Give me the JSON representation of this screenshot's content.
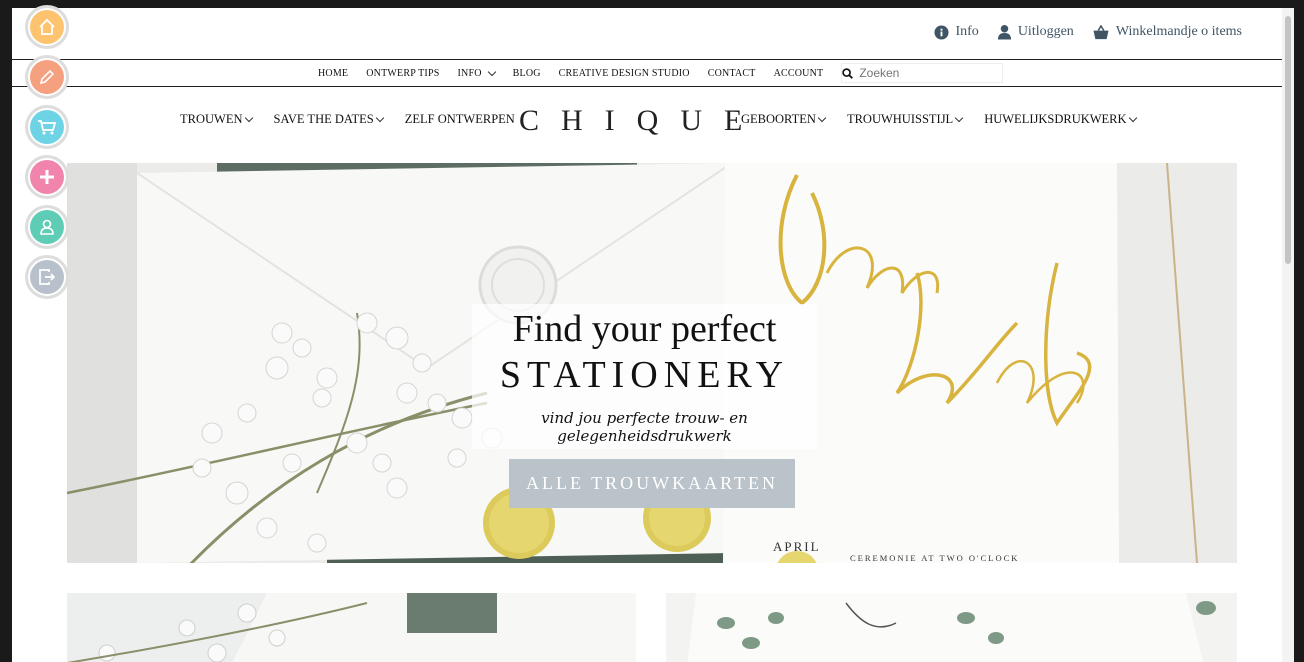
{
  "topbar": {
    "links": [
      {
        "label": "Info",
        "icon": "info-icon"
      },
      {
        "label": "Uitloggen",
        "icon": "user-icon"
      },
      {
        "label": "Winkelmandje o items",
        "icon": "basket-icon"
      }
    ]
  },
  "nav_small": {
    "items": [
      {
        "label": "HOME"
      },
      {
        "label": "ONTWERP TIPS"
      },
      {
        "label": "INFO",
        "dropdown": true
      },
      {
        "label": "BLOG"
      },
      {
        "label": "CREATIVE DESIGN STUDIO"
      },
      {
        "label": "CONTACT"
      },
      {
        "label": "ACCOUNT"
      }
    ],
    "search_placeholder": "Zoeken"
  },
  "nav_main": {
    "left": [
      {
        "label": "TROUWEN"
      },
      {
        "label": "SAVE THE DATES"
      },
      {
        "label": "ZELF ONTWERPEN"
      }
    ],
    "logo": "CHIQUE",
    "right": [
      {
        "label": "GEBOORTEN"
      },
      {
        "label": "TROUWHUISSTIJL"
      },
      {
        "label": "HUWELIJKSDRUKWERK"
      }
    ]
  },
  "hero": {
    "title_line1": "Find your perfect",
    "title_line2": "STATIONERY",
    "subtitle": "vind jou perfecte trouw- en gelegenheidsdrukwerk",
    "button": "ALLE TROUWKAARTEN",
    "card_names": "Laura and Bash",
    "card_month": "APRIL",
    "card_ceremony": "CEREMONIE AT TWO O'CLOCK"
  },
  "sidebar": {
    "buttons": [
      {
        "icon": "home-icon",
        "color": "#fdc36f"
      },
      {
        "icon": "pencil-icon",
        "color": "#f5a07e"
      },
      {
        "icon": "cart-icon",
        "color": "#6fd3e6"
      },
      {
        "icon": "plus-icon",
        "color": "#f084ad"
      },
      {
        "icon": "user-icon",
        "color": "#5fcdb5"
      },
      {
        "icon": "logout-icon",
        "color": "#b8c1cb"
      }
    ]
  },
  "colors": {
    "link": "#3f5565",
    "button": "#b9c3c9",
    "gold": "#d8b43e"
  }
}
